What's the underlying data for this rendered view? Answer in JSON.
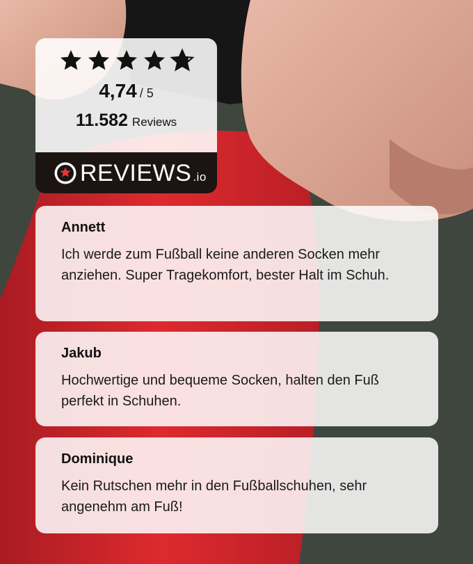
{
  "rating": {
    "stars": 4.74,
    "score": "4,74",
    "out_of": "/ 5",
    "count": "11.582",
    "count_label": "Reviews",
    "brand": "REVIEWS",
    "brand_suffix": ".io"
  },
  "reviews": [
    {
      "name": "Annett",
      "text": "Ich werde zum Fußball keine anderen Socken mehr anziehen. Super Tragekomfort, bester Halt im Schuh."
    },
    {
      "name": "Jakub",
      "text": "Hochwertige und bequeme Socken, halten den Fuß perfekt in Schuhen."
    },
    {
      "name": "Dominique",
      "text": "Kein Rutschen mehr in den Fußballschuhen, sehr angenehm am Fuß!"
    }
  ],
  "colors": {
    "sock_red": "#d8262c",
    "brand_dark": "#1b1412",
    "card": "#ffffff"
  }
}
